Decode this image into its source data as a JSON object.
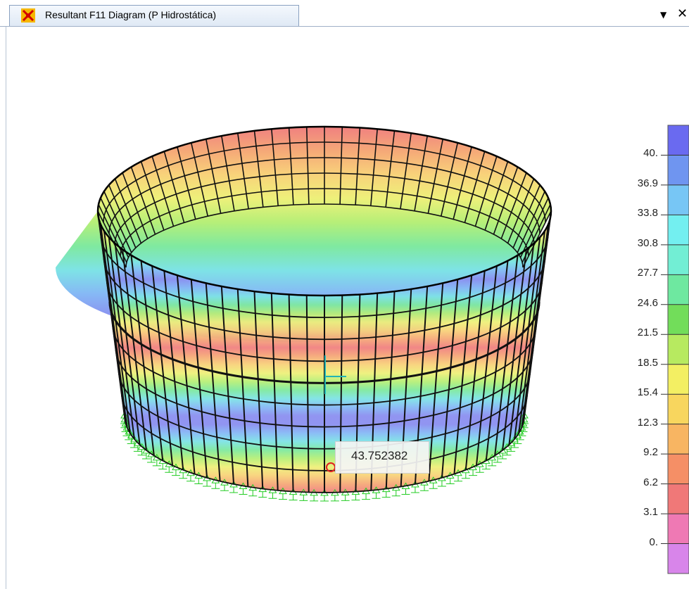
{
  "window": {
    "tab_title": "Resultant F11 Diagram  (P Hidrostática)",
    "menu_icon": "dropdown-arrow-icon",
    "close_icon": "close-icon",
    "app_icon": "sap-app-icon"
  },
  "diagram": {
    "probe_value": "43.752382",
    "band_colors": [
      "#f08080",
      "#f5a878",
      "#f8d27a",
      "#eef07a",
      "#b6ef78",
      "#7fe9a0",
      "#7ee3e6",
      "#86b8f5",
      "#8b8ff0"
    ]
  },
  "legend": {
    "labels": [
      "40.",
      "36.9",
      "33.8",
      "30.8",
      "27.7",
      "24.6",
      "21.5",
      "18.5",
      "15.4",
      "12.3",
      "9.2",
      "6.2",
      "3.1",
      "0."
    ],
    "colors": [
      "#6a6af0",
      "#6f95f0",
      "#77c6f5",
      "#73eff0",
      "#72eed4",
      "#6ee8a0",
      "#72dd5a",
      "#b7ea60",
      "#f3ef63",
      "#f8d65e",
      "#f8b562",
      "#f58f66",
      "#f07878",
      "#ef79b4",
      "#d885ea"
    ]
  }
}
